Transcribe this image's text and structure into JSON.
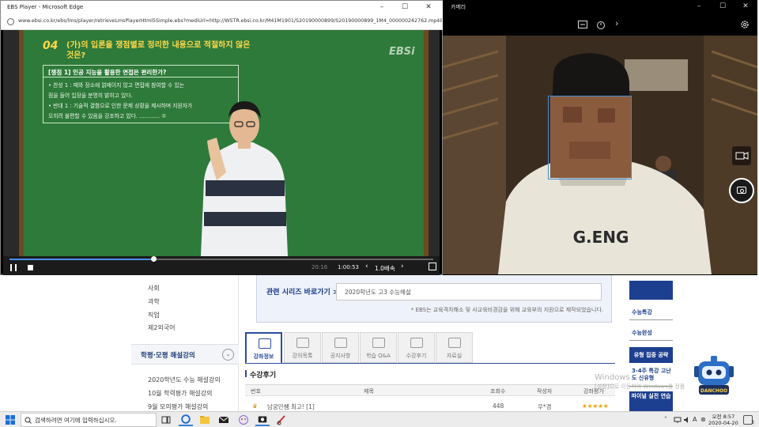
{
  "edge": {
    "title": "EBS Player - Microsoft Edge",
    "url": "www.ebsi.co.kr/ebs/lms/player/retrieveLmsPlayerHtml5Simple.ebs?mediUrl=http://WSTR.ebsi.co.kr/M41M1901/S20190000899/S20190000899_1M4_000000242762.mp4&mode=0&sbjtag"
  },
  "lecture": {
    "question_number": "04",
    "question_text": "(가)의 입론을 쟁점별로 정리한 내용으로 적절하지 않은 것은?",
    "logo": "EBSi",
    "case_title": "[쟁점 1] 인공 지능을 활용한 면접은 편리한가?",
    "case_lines": [
      "• 찬성 1 : 때와 장소에 얽매이지 않고 면접에 참여할 수 있는",
      "  점을 들어 입장을 분명히 밝히고 있다.",
      "• 반대 1 : 기술적 결함으로 인한 문제 상황을 제시하며 지원자가",
      "  오히려 불편할 수 있음을 강조하고 있다. ............ ①"
    ]
  },
  "player": {
    "time_total": "20:16",
    "time_current": "1:00:53",
    "speed_label": "1.0배속",
    "speed_dec": "‹",
    "speed_inc": "›",
    "progress": 0.34
  },
  "camera": {
    "title": "카메라"
  },
  "page": {
    "left_menu": [
      "사회",
      "과학",
      "직업",
      "제2외국어"
    ],
    "section_title": "학평·모평 해설강의",
    "section_items": [
      "2020학년도 수능 해설강의",
      "10월 학력평가 해설강의",
      "9월 모의평가 해설강의"
    ],
    "series_title": "관련 시리즈 바로가기 >",
    "series_select": "2020학년도 고3 수능해설",
    "series_note": "* EBS는 교육격차해소 및 사교육비경감을 위해 교육부의 지원으로 제작되었습니다.",
    "tabs": [
      "강좌정보",
      "강의목록",
      "공지사항",
      "학습 Q&A",
      "수강후기",
      "자료실"
    ],
    "reviews_title": "수강후기",
    "reviews_headers": [
      "번호",
      "제목",
      "조회수",
      "작성자",
      "강좌평가"
    ],
    "review_row": {
      "title": "남궁민쌤 최고! [1]",
      "views": "448",
      "author": "우*경",
      "rating": "★★★★★"
    },
    "banners": [
      "수능특강",
      "수능완성",
      "유형 집중 공략",
      "3-4주 특강 고난도 신유형",
      "파이널 실전 연습"
    ],
    "mascot_label": "DANCHOO",
    "watermark_title": "Windows",
    "watermark_sub": "[설정]으로 이동하여 Windows를 정품"
  },
  "taskbar": {
    "search_placeholder": "검색하려면 여기에 입력하십시오.",
    "time": "오전 8:57",
    "date": "2020-04-20",
    "notif_count": "3"
  }
}
